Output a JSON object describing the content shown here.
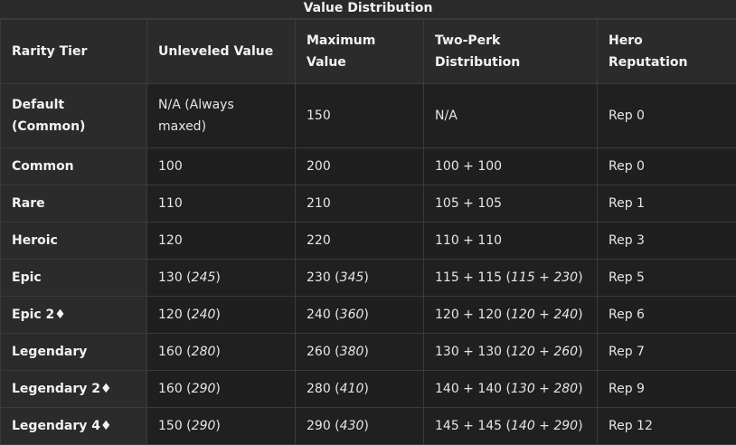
{
  "caption": "Value Distribution",
  "headers": [
    "Rarity Tier",
    "Unleveled Value",
    "Maximum Value",
    "Two-Perk Distribution",
    "Hero Reputation"
  ],
  "rows": [
    {
      "tier": "Default (Common)",
      "unleveled": "N/A (Always maxed)",
      "unleveled_alt": "",
      "max": "150",
      "max_alt": "",
      "perk": "N/A",
      "perk_alt": "",
      "rep": "Rep 0"
    },
    {
      "tier": "Common",
      "unleveled": "100",
      "unleveled_alt": "",
      "max": "200",
      "max_alt": "",
      "perk": "100 + 100",
      "perk_alt": "",
      "rep": "Rep 0"
    },
    {
      "tier": "Rare",
      "unleveled": "110",
      "unleveled_alt": "",
      "max": "210",
      "max_alt": "",
      "perk": "105 + 105",
      "perk_alt": "",
      "rep": "Rep 1"
    },
    {
      "tier": "Heroic",
      "unleveled": "120",
      "unleveled_alt": "",
      "max": "220",
      "max_alt": "",
      "perk": "110 + 110",
      "perk_alt": "",
      "rep": "Rep 3"
    },
    {
      "tier": "Epic",
      "unleveled": "130",
      "unleveled_alt": "245",
      "max": "230",
      "max_alt": "345",
      "perk": "115 + 115",
      "perk_alt": "115 + 230",
      "rep": "Rep 5"
    },
    {
      "tier": "Epic 2♦",
      "unleveled": "120",
      "unleveled_alt": "240",
      "max": "240",
      "max_alt": "360",
      "perk": "120 + 120",
      "perk_alt": "120 + 240",
      "rep": "Rep 6"
    },
    {
      "tier": "Legendary",
      "unleveled": "160",
      "unleveled_alt": "280",
      "max": "260",
      "max_alt": "380",
      "perk": "130 + 130",
      "perk_alt": "120 + 260",
      "rep": "Rep 7"
    },
    {
      "tier": "Legendary 2♦",
      "unleveled": "160",
      "unleveled_alt": "290",
      "max": "280",
      "max_alt": "410",
      "perk": "140 + 140",
      "perk_alt": "130 + 280",
      "rep": "Rep 9"
    },
    {
      "tier": "Legendary 4♦",
      "unleveled": "150",
      "unleveled_alt": "290",
      "max": "290",
      "max_alt": "430",
      "perk": "145 + 145",
      "perk_alt": "140 + 290",
      "rep": "Rep 12"
    }
  ]
}
